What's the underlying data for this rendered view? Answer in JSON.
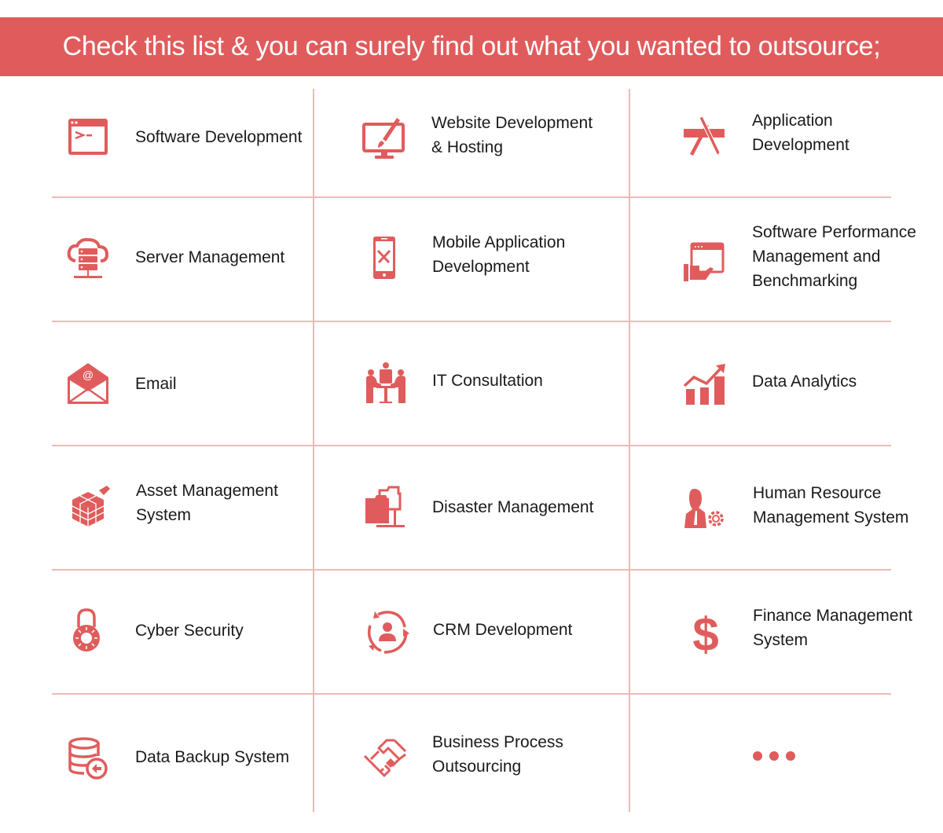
{
  "banner": {
    "title": "Check this list & you can surely find out what you wanted to outsource;"
  },
  "colors": {
    "accent": "#e05c5c",
    "grid_line": "#f2b8b8",
    "text": "#1a1a1a",
    "banner_text": "#ffffff"
  },
  "services": [
    {
      "label": "Software Development",
      "icon": "terminal-window-icon"
    },
    {
      "label": "Website Development\n& Hosting",
      "icon": "monitor-brush-icon"
    },
    {
      "label": "Application\nDevelopment",
      "icon": "app-store-icon"
    },
    {
      "label": "Server Management",
      "icon": "cloud-server-icon"
    },
    {
      "label": "Mobile Application\nDevelopment",
      "icon": "mobile-tools-icon"
    },
    {
      "label": "Software Performance\nManagement and\nBenchmarking",
      "icon": "hand-window-icon"
    },
    {
      "label": "Email",
      "icon": "envelope-at-icon"
    },
    {
      "label": "IT Consultation",
      "icon": "meeting-people-icon"
    },
    {
      "label": "Data Analytics",
      "icon": "bar-chart-trend-icon"
    },
    {
      "label": "Asset Management\nSystem",
      "icon": "cubes-icon"
    },
    {
      "label": "Disaster Management",
      "icon": "network-folders-icon"
    },
    {
      "label": "Human Resource\nManagement System",
      "icon": "person-gear-icon"
    },
    {
      "label": "Cyber Security",
      "icon": "padlock-icon"
    },
    {
      "label": "CRM Development",
      "icon": "user-cycle-icon"
    },
    {
      "label": "Finance Management\nSystem",
      "icon": "dollar-icon"
    },
    {
      "label": "Data Backup System",
      "icon": "database-restore-icon"
    },
    {
      "label": "Business Process\nOutsourcing",
      "icon": "handshake-icon"
    },
    {
      "label": "",
      "icon": "more-dots-icon"
    }
  ]
}
